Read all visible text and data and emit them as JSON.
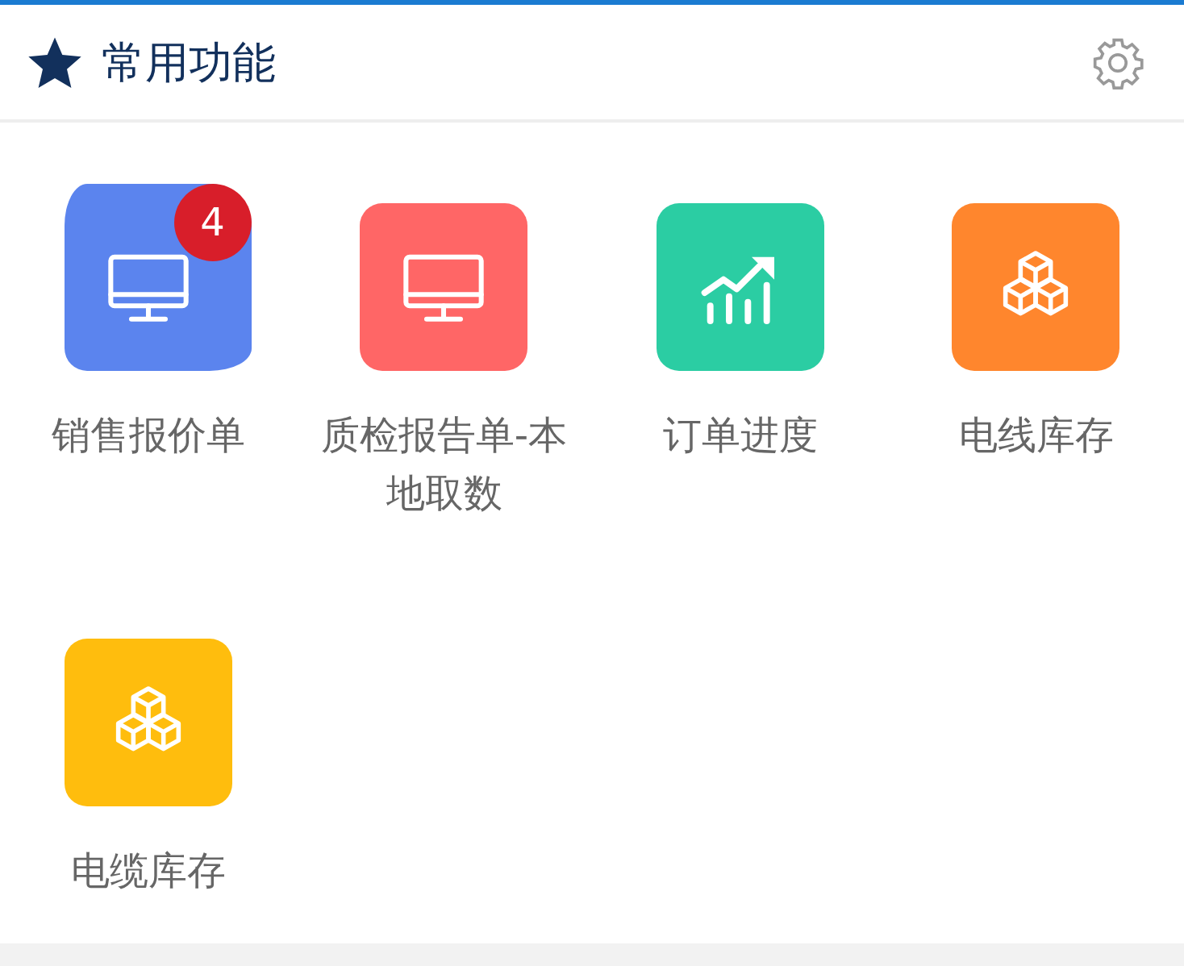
{
  "header": {
    "title": "常用功能"
  },
  "items": [
    {
      "label": "销售报价单",
      "kind": "monitor",
      "color": "#5b84ee",
      "badge": "4"
    },
    {
      "label": "质检报告单-本地取数",
      "kind": "monitor",
      "color": "#ff6666"
    },
    {
      "label": "订单进度",
      "kind": "chart",
      "color": "#2bcda3"
    },
    {
      "label": "电线库存",
      "kind": "cubes",
      "color": "#ff862d"
    },
    {
      "label": "电缆库存",
      "kind": "cubes",
      "color": "#ffbd0d"
    }
  ]
}
